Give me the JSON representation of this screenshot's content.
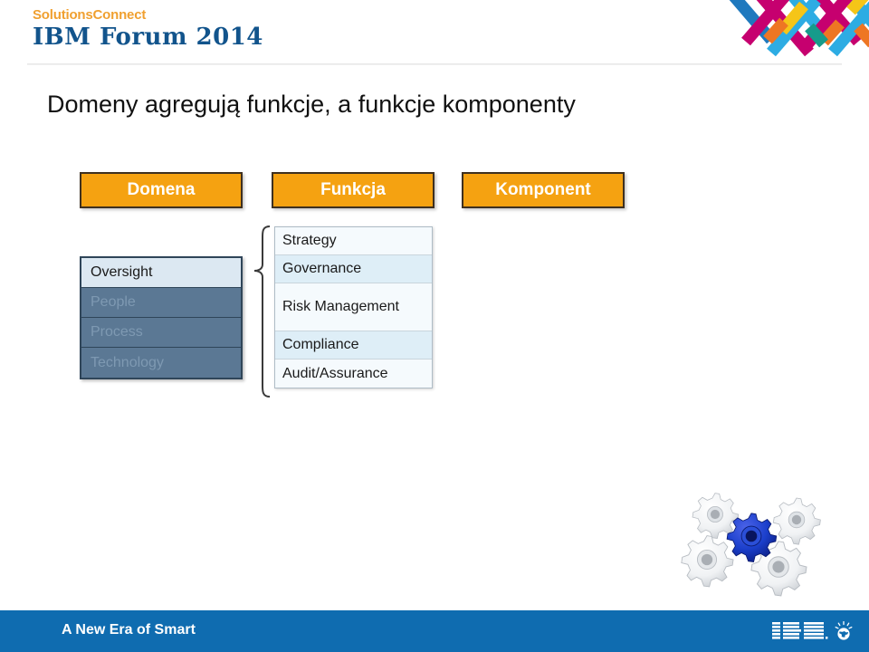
{
  "header": {
    "brand_line1": "SolutionsConnect",
    "brand_line2": "IBM Forum 2014",
    "logo_name": "ibm-solutions-connect-chevron-logo",
    "logo_colors": [
      "#C6006F",
      "#1F79BE",
      "#F5C518",
      "#2DACE3",
      "#EE7623",
      "#169B8B"
    ]
  },
  "title": "Domeny agregują funkcje, a funkcje komponenty",
  "diagram": {
    "columns": [
      {
        "id": "domena",
        "label": "Domena"
      },
      {
        "id": "funkcja",
        "label": "Funkcja"
      },
      {
        "id": "komponent",
        "label": "Komponent"
      }
    ],
    "header_fill": "#F5A211",
    "header_border": "#3E3020",
    "header_text_color": "#FFFFFF",
    "domains": [
      {
        "label": "Oversight",
        "state": "active"
      },
      {
        "label": "People",
        "state": "dim"
      },
      {
        "label": "Process",
        "state": "dim"
      },
      {
        "label": "Technology",
        "state": "dim"
      }
    ],
    "domain_active_bg": "#DCE8F2",
    "domain_dim_bg": "#5B7894",
    "domain_dim_text": "#7E99B2",
    "domain_border": "#2F4559",
    "functions": [
      {
        "label": "Strategy",
        "shade": "a"
      },
      {
        "label": "Governance",
        "shade": "b"
      },
      {
        "label": "Risk Management",
        "shade": "a"
      },
      {
        "label": "Compliance",
        "shade": "b"
      },
      {
        "label": "Audit/Assurance",
        "shade": "a"
      }
    ],
    "function_shade_a": "#F5FAFD",
    "function_shade_b": "#DEEEF7",
    "connector_name": "curly-brace-connector",
    "components": []
  },
  "decoration": {
    "gears_name": "gears-illustration",
    "gear_accent_color": "#1B3FCB",
    "gear_body_color": "#E8EAEC"
  },
  "footer": {
    "tagline": "A New Era of Smart",
    "bar_color": "#0F6CB0",
    "ibm_wordmark": "IBM",
    "planet_icon_name": "smarter-planet-icon"
  }
}
